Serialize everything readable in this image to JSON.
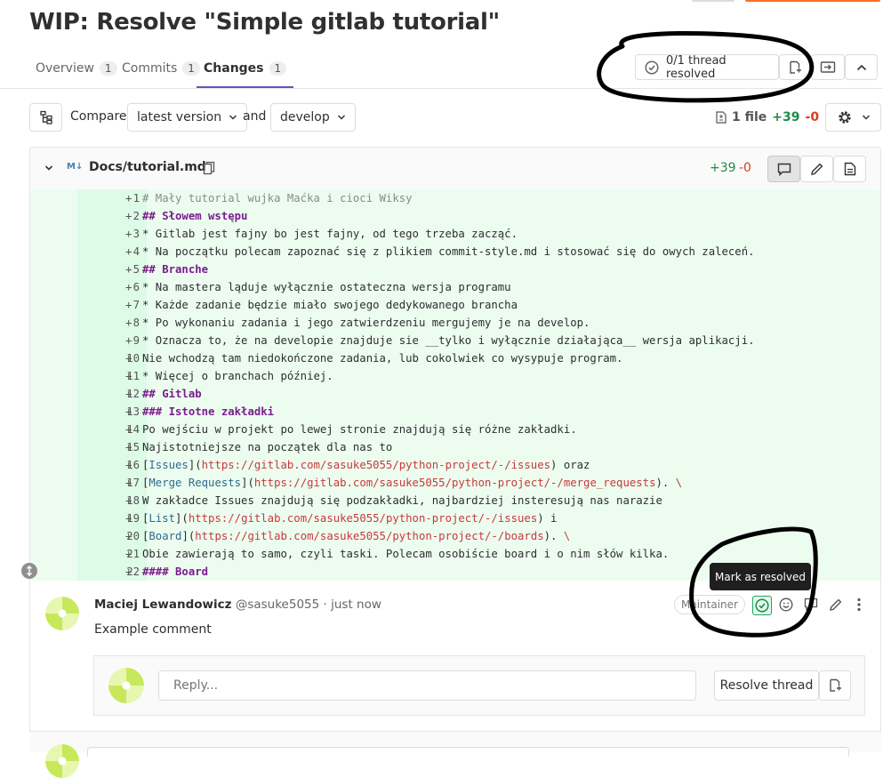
{
  "title": "WIP: Resolve \"Simple gitlab tutorial\"",
  "tabs": [
    {
      "label": "Overview",
      "count": "1"
    },
    {
      "label": "Commits",
      "count": "1"
    },
    {
      "label": "Changes",
      "count": "1"
    }
  ],
  "thread_status": "0/1 thread resolved",
  "compare": {
    "label": "Compare",
    "from": "latest version",
    "and": "and",
    "to": "develop"
  },
  "stats": {
    "files": "1 file",
    "additions": "+39",
    "deletions": "-0"
  },
  "file": {
    "path": "Docs/tutorial.md",
    "type_badge": "M↓",
    "additions": "+39",
    "deletions": "-0"
  },
  "lines": [
    {
      "n": "1",
      "segs": [
        {
          "t": "# Mały tutorial wujka Maćka i cioci Wiksy",
          "c": "comment"
        }
      ]
    },
    {
      "n": "2",
      "segs": [
        {
          "t": "## Słowem wstępu",
          "c": "head"
        }
      ]
    },
    {
      "n": "3",
      "segs": [
        {
          "t": "* Gitlab jest fajny bo jest fajny, od tego trzeba zacząć.",
          "c": ""
        }
      ]
    },
    {
      "n": "4",
      "segs": [
        {
          "t": "* Na początku polecam zapoznać się z plikiem commit-style.md i stosować się do owych zaleceń.",
          "c": ""
        }
      ]
    },
    {
      "n": "5",
      "segs": [
        {
          "t": "## Branche",
          "c": "head"
        }
      ]
    },
    {
      "n": "6",
      "segs": [
        {
          "t": "* Na mastera ląduje wyłącznie ostateczna wersja programu",
          "c": ""
        }
      ]
    },
    {
      "n": "7",
      "segs": [
        {
          "t": "* Każde zadanie będzie miało swojego dedykowanego brancha",
          "c": ""
        }
      ]
    },
    {
      "n": "8",
      "segs": [
        {
          "t": "* Po wykonaniu zadania i jego zatwierdzeniu mergujemy je na develop.",
          "c": ""
        }
      ]
    },
    {
      "n": "9",
      "segs": [
        {
          "t": "* Oznacza to, że na developie znajduje sie __tylko i wyłącznie działająca__ wersja aplikacji.",
          "c": ""
        }
      ]
    },
    {
      "n": "10",
      "segs": [
        {
          "t": "Nie wchodzą tam niedokończone zadania, lub cokolwiek co wysypuje program.",
          "c": ""
        }
      ]
    },
    {
      "n": "11",
      "segs": [
        {
          "t": "* Więcej o branchach później.",
          "c": ""
        }
      ]
    },
    {
      "n": "12",
      "segs": [
        {
          "t": "## Gitlab",
          "c": "head"
        }
      ]
    },
    {
      "n": "13",
      "segs": [
        {
          "t": "### Istotne zakładki",
          "c": "head"
        }
      ]
    },
    {
      "n": "14",
      "segs": [
        {
          "t": "Po wejściu w projekt po lewej stronie znajdują się różne zakładki.",
          "c": ""
        }
      ]
    },
    {
      "n": "15",
      "segs": [
        {
          "t": "Najistotniejsze na początek dla nas to",
          "c": ""
        }
      ]
    },
    {
      "n": "16",
      "segs": [
        {
          "t": "[",
          "c": ""
        },
        {
          "t": "Issues",
          "c": "link"
        },
        {
          "t": "](",
          "c": ""
        },
        {
          "t": "https://gitlab.com/sasuke5055/python-project/-/issues",
          "c": "url"
        },
        {
          "t": ") oraz",
          "c": ""
        }
      ]
    },
    {
      "n": "17",
      "segs": [
        {
          "t": "[",
          "c": ""
        },
        {
          "t": "Merge Requests",
          "c": "link"
        },
        {
          "t": "](",
          "c": ""
        },
        {
          "t": "https://gitlab.com/sasuke5055/python-project/-/merge_requests",
          "c": "url"
        },
        {
          "t": "). ",
          "c": ""
        },
        {
          "t": "\\",
          "c": "url"
        }
      ]
    },
    {
      "n": "18",
      "segs": [
        {
          "t": "W zakładce Issues znajdują się podzakładki, najbardziej insteresują nas narazie",
          "c": ""
        }
      ]
    },
    {
      "n": "19",
      "segs": [
        {
          "t": "[",
          "c": ""
        },
        {
          "t": "List",
          "c": "link"
        },
        {
          "t": "](",
          "c": ""
        },
        {
          "t": "https://gitlab.com/sasuke5055/python-project/-/issues",
          "c": "url"
        },
        {
          "t": ") i",
          "c": ""
        }
      ]
    },
    {
      "n": "20",
      "segs": [
        {
          "t": "[",
          "c": ""
        },
        {
          "t": "Board",
          "c": "link"
        },
        {
          "t": "](",
          "c": ""
        },
        {
          "t": "https://gitlab.com/sasuke5055/python-project/-/boards",
          "c": "url"
        },
        {
          "t": "). ",
          "c": ""
        },
        {
          "t": "\\",
          "c": "url"
        }
      ]
    },
    {
      "n": "21",
      "segs": [
        {
          "t": "Obie zawierają to samo, czyli taski. Polecam osobiście board i o nim słów kilka.",
          "c": ""
        }
      ]
    },
    {
      "n": "22",
      "segs": [
        {
          "t": "#### Board",
          "c": "head"
        }
      ]
    }
  ],
  "comment": {
    "author": "Maciej Lewandowicz",
    "username": "@sasuke5055",
    "time": "· just now",
    "role": "Maintainer",
    "body": "Example comment"
  },
  "tooltip": "Mark as resolved",
  "reply": {
    "placeholder": "Reply...",
    "resolve_label": "Resolve thread"
  },
  "colors": {
    "accent": "#6b4fbb",
    "add_bg": "#ecfdf0",
    "addition": "#1f8b46",
    "deletion": "#db3b21",
    "annotation": "#000000"
  },
  "icons": [
    "check-circle-icon",
    "resolve-discussion-icon",
    "jump-next-icon",
    "chevron-up-icon",
    "file-tree-icon",
    "gear-icon",
    "file-diff-icon",
    "markdown-icon",
    "copy-icon",
    "comment-icon",
    "pencil-icon",
    "view-file-icon",
    "emoji-icon",
    "more-vertical-icon",
    "expand-icon"
  ]
}
